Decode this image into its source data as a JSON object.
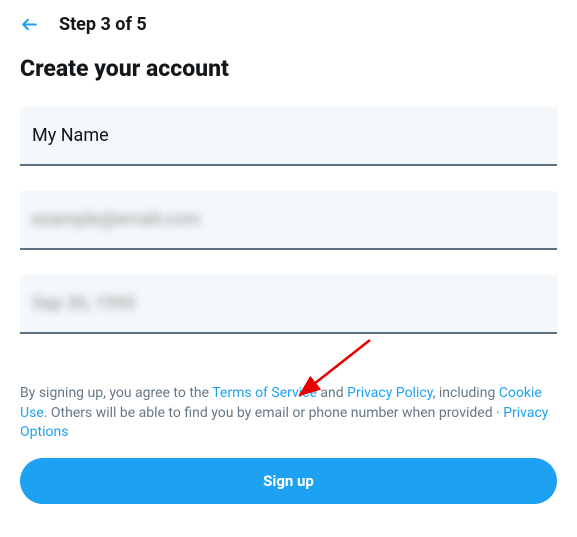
{
  "header": {
    "step": "Step 3 of 5"
  },
  "title": "Create your account",
  "form": {
    "name_value": "My Name",
    "email_value": "example@email.com",
    "dob_value": "Sep 30, 1990"
  },
  "legal": {
    "prefix": "By signing up, you agree to the ",
    "tos": "Terms of Service",
    "and": " and ",
    "privacy": "Privacy Policy",
    "including": ", including ",
    "cookie": "Cookie Use",
    "others": ". Others will be able to find you by email or phone number when provided · ",
    "privacy_options": "Privacy Options"
  },
  "signup_label": "Sign up"
}
